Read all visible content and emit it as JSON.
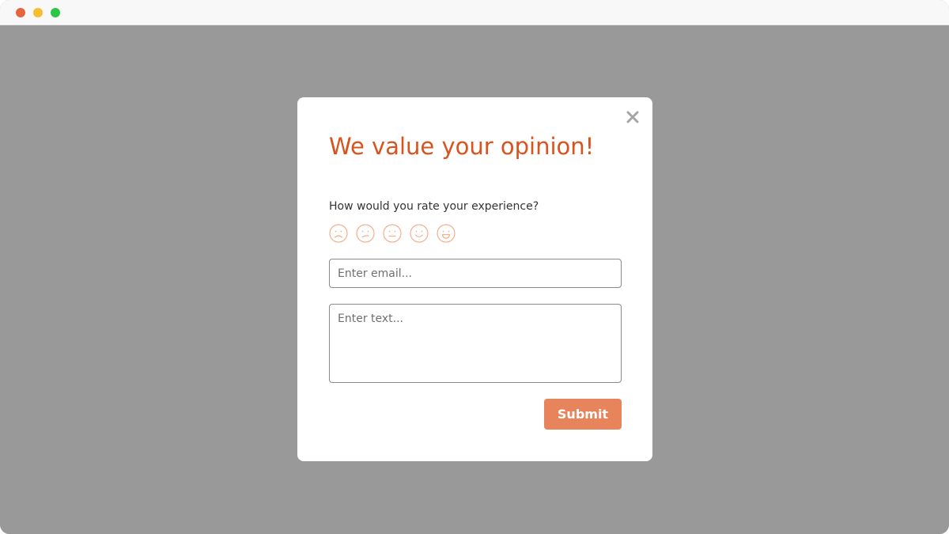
{
  "window": {
    "controls": [
      "close",
      "minimize",
      "maximize"
    ]
  },
  "colors": {
    "accent": "#d9531e",
    "button": "#e8845b",
    "face_stroke": "#f2b08f",
    "close_icon": "#a6a6a6",
    "overlay": "#999999",
    "dot_red": "#e5653e",
    "dot_yellow": "#f5bd2f",
    "dot_green": "#2dc545"
  },
  "modal": {
    "title": "We value your opinion!",
    "question": "How would you rate your experience?",
    "rating_icons": [
      "very-sad-face-icon",
      "slightly-sad-face-icon",
      "neutral-face-icon",
      "smile-face-icon",
      "very-happy-face-icon"
    ],
    "email_placeholder": "Enter email...",
    "message_placeholder": "Enter text...",
    "submit_label": "Submit"
  }
}
